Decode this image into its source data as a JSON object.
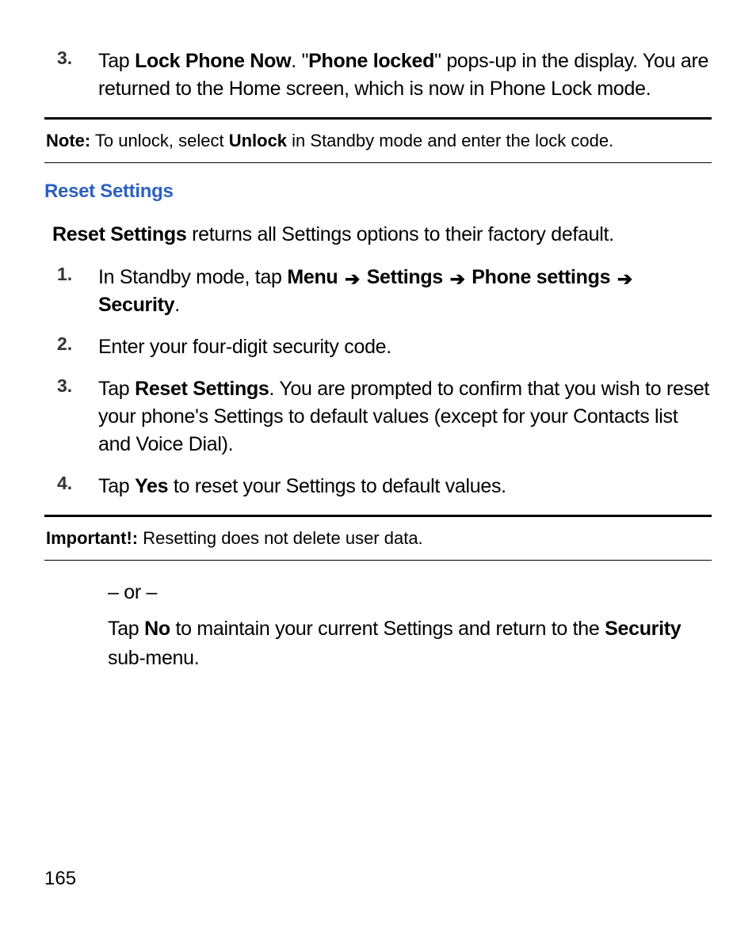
{
  "top_list": {
    "item3": {
      "num": "3.",
      "prefix": "Tap ",
      "bold1": "Lock Phone Now",
      "mid1": ". \"",
      "bold2": "Phone locked",
      "suffix": "\" pops-up in the display. You are returned to the Home screen, which is now in Phone Lock mode."
    }
  },
  "note": {
    "label": "Note:",
    "text_before": " To unlock, select ",
    "bold": "Unlock",
    "text_after": " in Standby mode and enter the lock code."
  },
  "section_heading": "Reset Settings",
  "intro": {
    "bold": "Reset Settings",
    "rest": " returns all Settings options to their factory default."
  },
  "steps": {
    "s1": {
      "num": "1.",
      "t1": "In Standby mode, tap ",
      "b1": "Menu",
      "b2": "Settings",
      "b3": "Phone settings",
      "b4": "Security",
      "period": "."
    },
    "s2": {
      "num": "2.",
      "text": "Enter your four-digit security code."
    },
    "s3": {
      "num": "3.",
      "t1": "Tap ",
      "b1": "Reset Settings",
      "t2": ". You are prompted to confirm that you wish to reset your phone's Settings to default values (except for your Contacts list and Voice Dial)."
    },
    "s4": {
      "num": "4.",
      "t1": "Tap ",
      "b1": "Yes",
      "t2": " to reset your Settings to default values."
    }
  },
  "important": {
    "label": "Important!:",
    "text": " Resetting does not delete user data."
  },
  "alt": {
    "or": "– or –",
    "t1": "Tap ",
    "b1": "No",
    "t2": " to maintain your current Settings and return to the ",
    "b2": "Security",
    "t3": " sub-menu."
  },
  "page_number": "165"
}
